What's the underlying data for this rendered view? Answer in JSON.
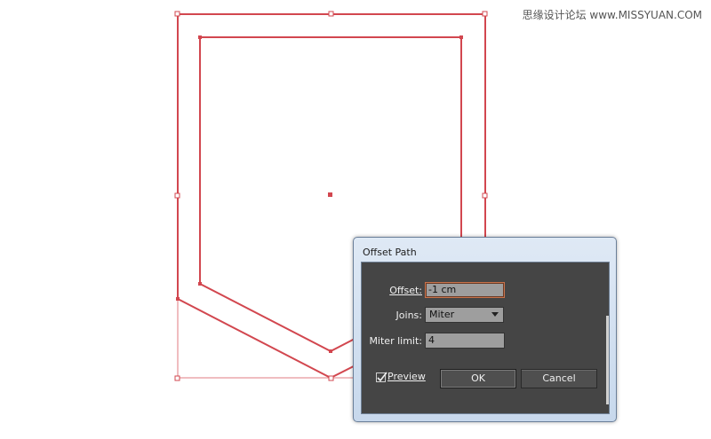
{
  "watermark": "思缘设计论坛 www.MISSYUAN.COM",
  "dialog": {
    "title": "Offset Path",
    "offset": {
      "label": "Offset:",
      "value": "-1 cm"
    },
    "joins": {
      "label": "Joins:",
      "value": "Miter"
    },
    "miter_limit": {
      "label": "Miter limit:",
      "value": "4"
    },
    "preview": {
      "label": "Preview",
      "checked": true
    },
    "ok_label": "OK",
    "cancel_label": "Cancel"
  },
  "colors": {
    "path_stroke": "#d2474f",
    "dialog_body": "#454545",
    "dialog_frame": "#c7d8ec"
  }
}
